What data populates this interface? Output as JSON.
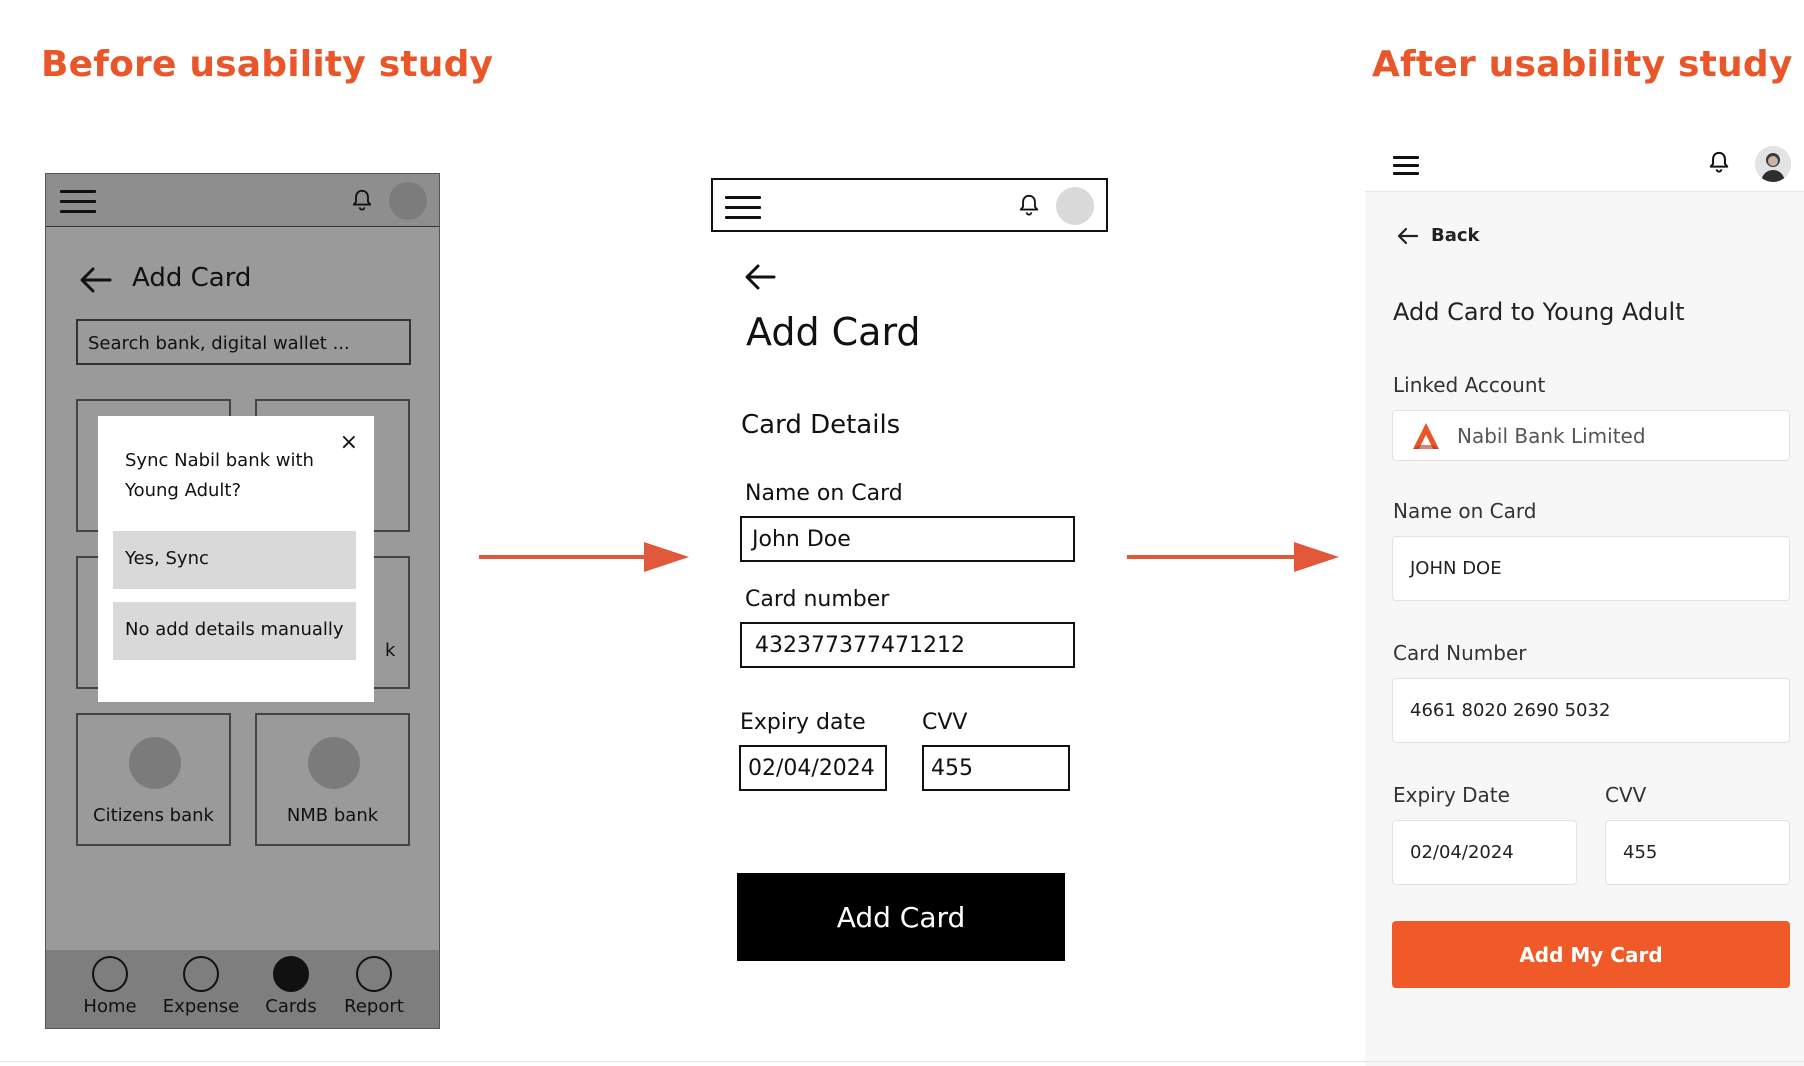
{
  "headings": {
    "before": "Before usability study",
    "after": "After usability study"
  },
  "colors": {
    "accent": "#e8562a",
    "primary_button": "#f05a28",
    "wireframe_gray": "#9a9a9a"
  },
  "wireframe_v1": {
    "title": "Add Card",
    "search_placeholder": "Search bank, digital wallet ...",
    "tiles": [
      "",
      "",
      "",
      "k",
      "Citizens bank",
      "NMB bank"
    ],
    "modal": {
      "message": "Sync Nabil bank with Young Adult?",
      "close": "×",
      "yes": "Yes, Sync",
      "no": "No add details manually"
    },
    "nav": [
      "Home",
      "Expense",
      "Cards",
      "Report"
    ],
    "active_nav": "Cards"
  },
  "wireframe_v2": {
    "title": "Add Card",
    "section": "Card Details",
    "name_label": "Name on Card",
    "name_value": "John Doe",
    "card_label": "Card number",
    "card_value": "432377377471212",
    "expiry_label": "Expiry date",
    "expiry_value": "02/04/2024",
    "cvv_label": "CVV",
    "cvv_value": "455",
    "button": "Add Card"
  },
  "final": {
    "back": "Back",
    "title": "Add Card to Young Adult",
    "linked_label": "Linked Account",
    "linked_value": "Nabil Bank Limited",
    "name_label": "Name on Card",
    "name_value": "JOHN DOE",
    "card_label": "Card Number",
    "card_value": "4661 8020 2690 5032",
    "expiry_label": "Expiry Date",
    "expiry_value": "02/04/2024",
    "cvv_label": "CVV",
    "cvv_value": "455",
    "button": "Add My Card"
  }
}
